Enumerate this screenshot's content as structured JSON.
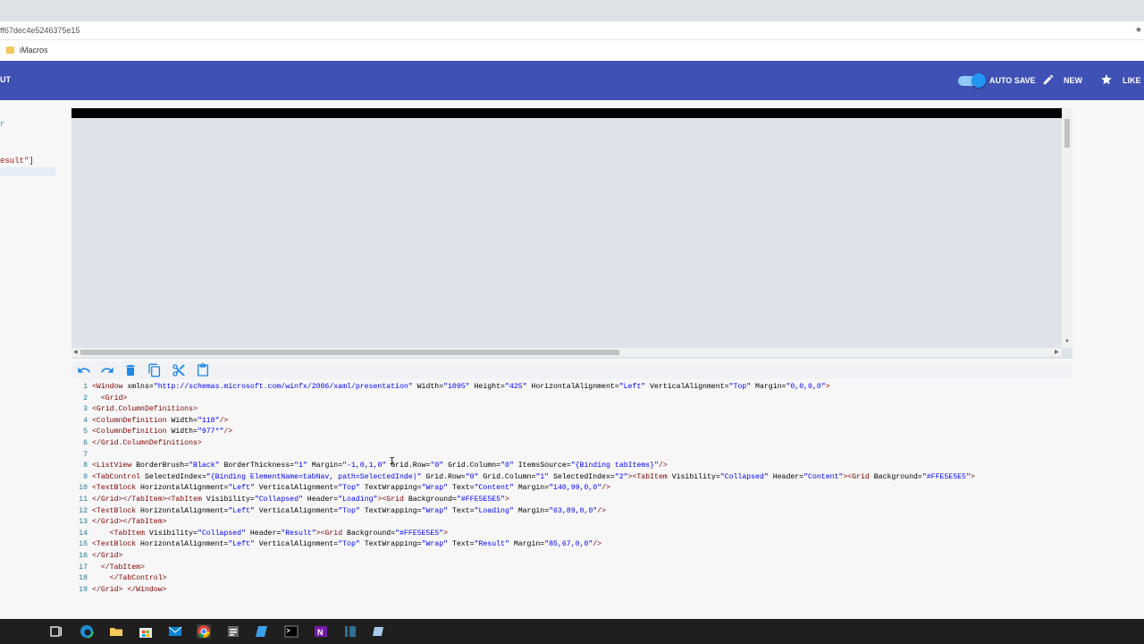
{
  "browser": {
    "url_fragment": "ff67dec4e5246375e15",
    "bookmark": "iMacros"
  },
  "appbar": {
    "left_label": "UT",
    "autosave_label": "AUTO SAVE",
    "new_label": "NEW",
    "like_label": "LIKE"
  },
  "side_panel": {
    "fragment1": "r",
    "fragment2_value": "esult\"",
    "fragment2_bracket": "]"
  },
  "toolbar": {
    "icons": [
      "undo-icon",
      "redo-icon",
      "delete-icon",
      "copy-icon",
      "cut-icon",
      "paste-icon"
    ]
  },
  "editor": {
    "lines": [
      {
        "n": "1",
        "code": "<Window xmlns=\"http://schemas.microsoft.com/winfx/2006/xaml/presentation\" Width=\"1095\" Height=\"425\" HorizontalAlignment=\"Left\" VerticalAlignment=\"Top\" Margin=\"0,0,0,0\">"
      },
      {
        "n": "2",
        "code": "  <Grid>"
      },
      {
        "n": "3",
        "code": "<Grid.ColumnDefinitions>"
      },
      {
        "n": "4",
        "code": "<ColumnDefinition Width=\"118\"/>"
      },
      {
        "n": "5",
        "code": "<ColumnDefinition Width=\"977*\"/>"
      },
      {
        "n": "6",
        "code": "</Grid.ColumnDefinitions>"
      },
      {
        "n": "7",
        "code": ""
      },
      {
        "n": "8",
        "code": "<ListView BorderBrush=\"Black\" BorderThickness=\"1\" Margin=\"-1,0,1,0\" Grid.Row=\"0\" Grid.Column=\"0\" ItemsSource=\"{Binding tabItems}\"/>"
      },
      {
        "n": "9",
        "code": "<TabControl SelectedIndex=\"{Binding ElementName=tabNav, path=SelectedInde|\" Grid.Row=\"0\" Grid.Column=\"1\" SelectedIndex=\"2\"><TabItem Visibility=\"Collapsed\" Header=\"Content\"><Grid Background=\"#FFE5E5E5\">"
      },
      {
        "n": "10",
        "code": "<TextBlock HorizontalAlignment=\"Left\" VerticalAlignment=\"Top\" TextWrapping=\"Wrap\" Text=\"Content\" Margin=\"140,99,0,0\"/>"
      },
      {
        "n": "11",
        "code": "</Grid></TabItem><TabItem Visibility=\"Collapsed\" Header=\"Loading\"><Grid Background=\"#FFE5E5E5\">"
      },
      {
        "n": "12",
        "code": "<TextBlock HorizontalAlignment=\"Left\" VerticalAlignment=\"Top\" TextWrapping=\"Wrap\" Text=\"Loading\" Margin=\"63,89,0,0\"/>"
      },
      {
        "n": "13",
        "code": "</Grid></TabItem>"
      },
      {
        "n": "14",
        "code": "    <TabItem Visibility=\"Collapsed\" Header=\"Result\"><Grid Background=\"#FFE5E5E5\">"
      },
      {
        "n": "15",
        "code": "<TextBlock HorizontalAlignment=\"Left\" VerticalAlignment=\"Top\" TextWrapping=\"Wrap\" Text=\"Result\" Margin=\"85,67,0,0\"/>"
      },
      {
        "n": "16",
        "code": "</Grid>"
      },
      {
        "n": "17",
        "code": "  </TabItem>"
      },
      {
        "n": "18",
        "code": "    </TabControl>"
      },
      {
        "n": "19",
        "code": "</Grid> </Window>"
      }
    ]
  },
  "taskbar": {
    "icons": [
      "task-view-icon",
      "edge-icon",
      "file-explorer-icon",
      "store-icon",
      "mail-icon",
      "chrome-icon",
      "settings-app-icon",
      "app-icon",
      "terminal-icon",
      "onenote-icon",
      "app-icon-2",
      "app-icon-3"
    ]
  },
  "colors": {
    "appbar": "#3f51b5",
    "toggle": "#2196f3",
    "toolbar_icon": "#1e88e5",
    "line_number": "#237893"
  }
}
